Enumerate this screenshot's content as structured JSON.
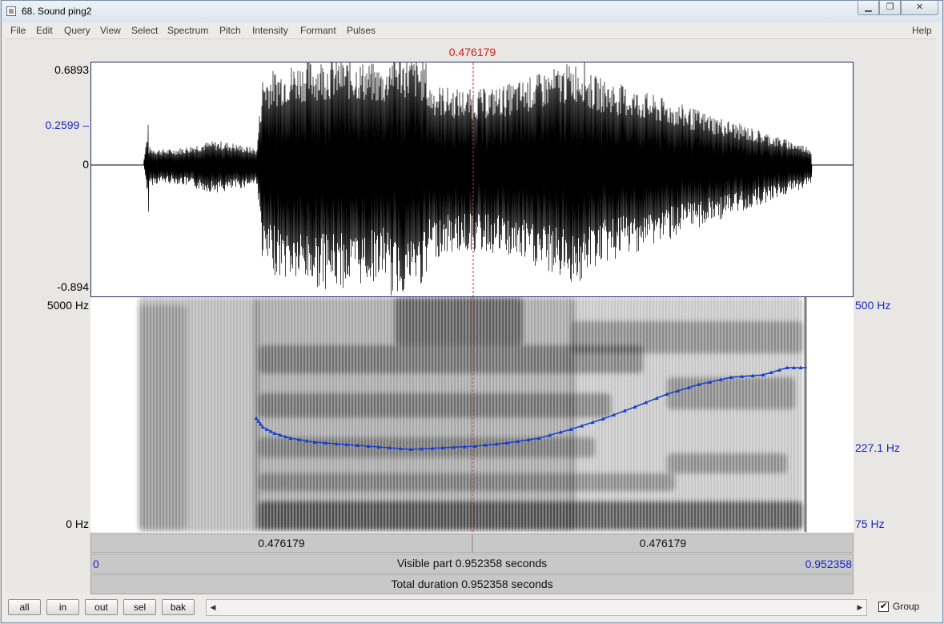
{
  "window": {
    "title": "68. Sound ping2"
  },
  "menu": {
    "items": [
      "File",
      "Edit",
      "Query",
      "View",
      "Select",
      "Spectrum",
      "Pitch",
      "Intensity",
      "Formant",
      "Pulses"
    ],
    "help": "Help"
  },
  "cursor": {
    "time": "0.476179"
  },
  "waveform": {
    "max_label": "0.6893",
    "level_label": "0.2599",
    "zero_label": "0",
    "min_label": "-0.894"
  },
  "spectrogram": {
    "top_label": "5000 Hz",
    "bottom_label": "0 Hz"
  },
  "pitch": {
    "top_label": "500 Hz",
    "mid_label": "227.1 Hz",
    "bottom_label": "75 Hz"
  },
  "time_bars": {
    "left_segment": "0.476179",
    "right_segment": "0.476179",
    "start": "0",
    "end": "0.952358",
    "visible_part": "Visible part 0.952358 seconds",
    "total_duration": "Total duration 0.952358 seconds"
  },
  "buttons": {
    "all": "all",
    "in": "in",
    "out": "out",
    "sel": "sel",
    "bak": "bak"
  },
  "group": {
    "label": "Group",
    "checked": true
  },
  "colors": {
    "cursor": "#d21a1a",
    "pitch": "#1a3fd0",
    "axis_blue": "#1b26c7"
  }
}
